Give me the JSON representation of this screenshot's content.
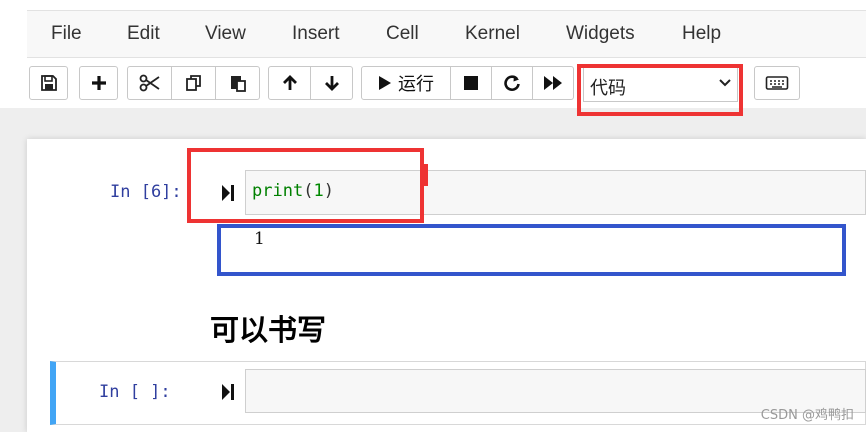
{
  "menu": {
    "items": [
      "File",
      "Edit",
      "View",
      "Insert",
      "Cell",
      "Kernel",
      "Widgets",
      "Help"
    ]
  },
  "toolbar": {
    "save_icon": "floppy-disk-icon",
    "add_icon": "plus-icon",
    "cut_icon": "scissors-icon",
    "copy_icon": "copy-icon",
    "paste_icon": "paste-icon",
    "move_up_icon": "arrow-up-icon",
    "move_down_icon": "arrow-down-icon",
    "run_label": "运行",
    "stop_icon": "stop-icon",
    "restart_icon": "restart-icon",
    "fast_forward_icon": "fast-forward-icon",
    "cell_type_value": "代码",
    "keyboard_icon": "keyboard-icon"
  },
  "cells": {
    "code_cell": {
      "prompt": "In  [6]:",
      "code_fn": "print",
      "code_open": "(",
      "code_arg": "1",
      "code_close": ")",
      "output": "1"
    },
    "markdown": {
      "text": "可以书写"
    },
    "empty_cell": {
      "prompt": "In  [ ]:"
    }
  },
  "annotations": {
    "red": "#ee3333",
    "blue": "#3355cc",
    "active_cell_color": "#42a5f5"
  },
  "watermark": "CSDN @鸡鸭扣"
}
